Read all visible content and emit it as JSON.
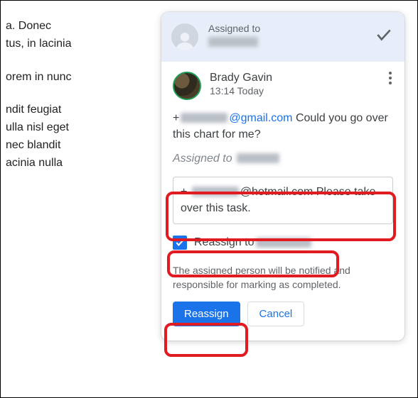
{
  "background": {
    "p1": "a. Donec\ntus, in lacinia",
    "p2": "orem in nunc",
    "p3": "ndit feugiat\nulla nisl eget\nnec blandit\nacinia nulla"
  },
  "header": {
    "label": "Assigned to",
    "assignee": "██████"
  },
  "comment": {
    "author": "Brady Gavin",
    "timestamp": "13:14 Today",
    "plus": "+",
    "redacted_user": "██████",
    "domain": "@gmail.com",
    "rest": " Could you go over this chart for me?",
    "assigned_line_prefix": "Assigned to ",
    "assigned_line_name": "██████"
  },
  "reply": {
    "plus": "+ ",
    "redacted_user": "██████",
    "domain": "@hotmail.com",
    "rest": " Please take over this task."
  },
  "reassign": {
    "checked": true,
    "label": "Reassign to ",
    "target": "██████"
  },
  "info": "The assigned person will be notified and responsible for marking as completed.",
  "buttons": {
    "primary": "Reassign",
    "cancel": "Cancel"
  }
}
